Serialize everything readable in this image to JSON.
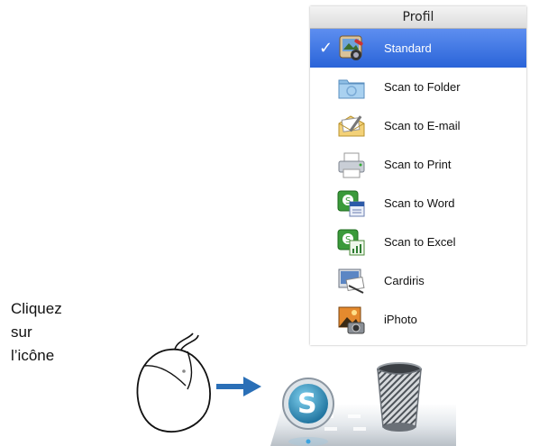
{
  "menu": {
    "title": "Profil",
    "check_mark": "✓",
    "items": [
      {
        "label": "Standard",
        "icon": "standard-scanner-icon",
        "selected": true
      },
      {
        "label": "Scan to Folder",
        "icon": "folder-icon",
        "selected": false
      },
      {
        "label": "Scan to E-mail",
        "icon": "email-icon",
        "selected": false
      },
      {
        "label": "Scan to Print",
        "icon": "printer-icon",
        "selected": false
      },
      {
        "label": "Scan to Word",
        "icon": "word-icon",
        "selected": false
      },
      {
        "label": "Scan to Excel",
        "icon": "excel-icon",
        "selected": false
      },
      {
        "label": "Cardiris",
        "icon": "cardiris-icon",
        "selected": false
      },
      {
        "label": "iPhoto",
        "icon": "iphoto-icon",
        "selected": false
      }
    ]
  },
  "instruction": {
    "line1": "Cliquez",
    "line2": "sur",
    "line3": "l’icône"
  },
  "dock": {
    "items": [
      "scansnap-manager-icon",
      "trash-icon"
    ]
  },
  "colors": {
    "selection": "#2a64d8",
    "arrow": "#2a6fb7"
  }
}
